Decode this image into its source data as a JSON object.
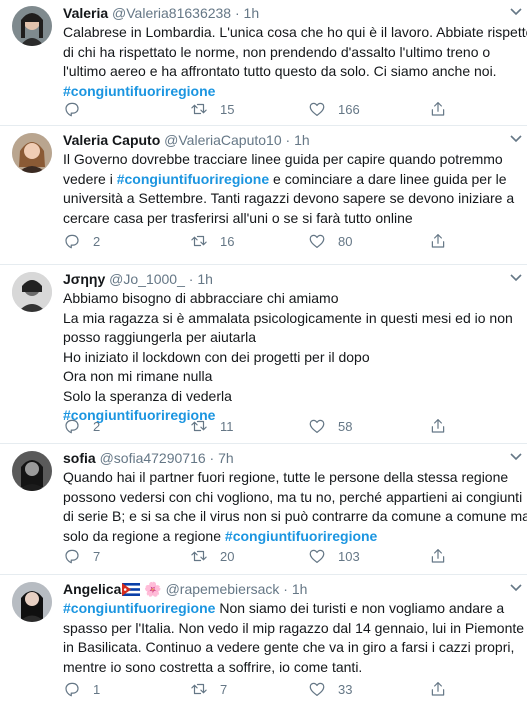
{
  "tweets": [
    {
      "name": "Valeria",
      "handle": "@Valeria81636238",
      "dot": "·",
      "time": "1h",
      "lines": [
        [
          "Calabrese in Lombardia. L'unica cosa che ho qui è il lavoro. Abbiate rispetto"
        ],
        [
          "di chi ha rispettato le norme, non prendendo d'assalto l'ultimo treno o"
        ],
        [
          "l'ultimo aereo e ha affrontato tutto questo da solo. Ci siamo anche noi."
        ],
        [
          {
            "tag": "#congiuntifuoriregione"
          }
        ]
      ],
      "replies": "",
      "retweets": "15",
      "likes": "166"
    },
    {
      "name": "Valeria Caputo",
      "handle": "@ValeriaCaputo10",
      "dot": "·",
      "time": "1h",
      "lines": [
        [
          "Il Governo dovrebbe tracciare linee guida per capire quando potremmo"
        ],
        [
          "vedere i ",
          {
            "tag": "#congiuntifuoriregione"
          },
          " e cominciare a dare linee guida per le"
        ],
        [
          "università a Settembre. Tanti ragazzi devono sapere se devono iniziare a"
        ],
        [
          "cercare casa per trasferirsi all'uni o se si farà tutto online"
        ]
      ],
      "replies": "2",
      "retweets": "16",
      "likes": "80"
    },
    {
      "name": "Јσηηу",
      "handle": "@Jo_1000_",
      "dot": "·",
      "time": "1h",
      "lines": [
        [
          "Abbiamo bisogno di abbracciare chi amiamo"
        ],
        [
          "La mia ragazza si è ammalata psicologicamente in questi mesi ed io non"
        ],
        [
          "posso raggiungerla per aiutarla"
        ],
        [
          "Ho iniziato il lockdown con dei progetti per il dopo"
        ],
        [
          "Ora non mi rimane nulla"
        ],
        [
          "Solo la speranza di vederla"
        ],
        [
          {
            "tag": "#congiuntifuoriregione"
          }
        ]
      ],
      "replies": "2",
      "retweets": "11",
      "likes": "58"
    },
    {
      "name": "sofia",
      "handle": "@sofia47290716",
      "dot": "·",
      "time": "7h",
      "lines": [
        [
          "Quando hai il partner fuori regione, tutte le persone della stessa regione"
        ],
        [
          "possono vedersi con chi vogliono, ma tu no, perché appartieni ai congiunti"
        ],
        [
          "di serie B; e si sa che il virus non si può contrarre da comune a comune ma"
        ],
        [
          "solo da regione a regione ",
          {
            "tag": "#congiuntifuoriregione"
          }
        ]
      ],
      "replies": "7",
      "retweets": "20",
      "likes": "103"
    },
    {
      "name": "Angelica",
      "name_emoji": "🌸",
      "handle": "@rapemebiersack",
      "dot": "·",
      "time": "1h",
      "lines": [
        [
          {
            "tag": "#congiuntifuoriregione"
          },
          " Non siamo dei turisti e non vogliamo andare a"
        ],
        [
          "spasso per l'Italia. Non vedo il mip ragazzo dal 14 gennaio, lui in Piemonte io"
        ],
        [
          "in Basilicata. Continuo a vedere gente che va in giro a farsi i cazzi propri,"
        ],
        [
          "mentre io sono costretta a soffrire, io come tanti."
        ]
      ],
      "replies": "1",
      "retweets": "7",
      "likes": "33"
    }
  ],
  "colors": {
    "hashtag": "#1b95e0",
    "muted": "#657786",
    "divider": "#e6ecf0"
  }
}
